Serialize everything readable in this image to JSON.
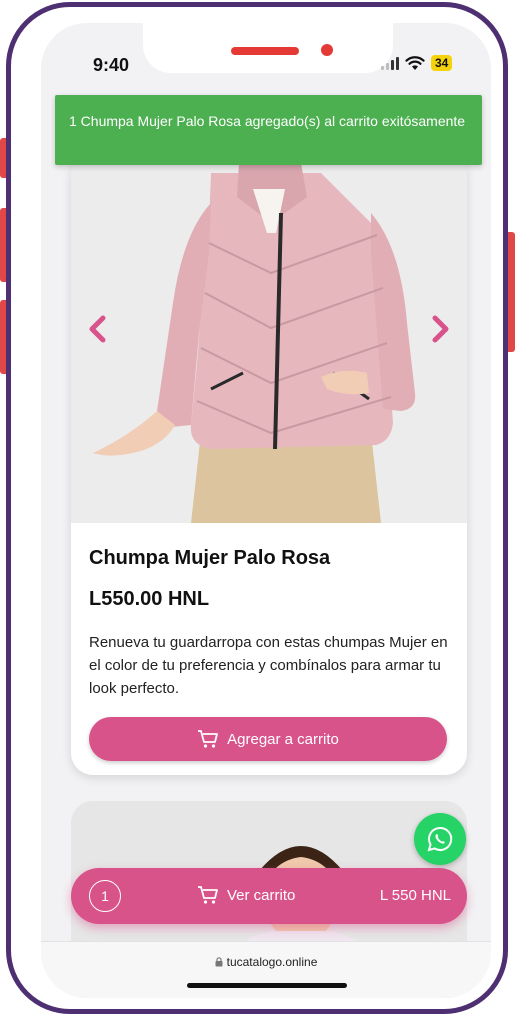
{
  "status_bar": {
    "time": "9:40",
    "battery": "34"
  },
  "toast": {
    "message": "1 Chumpa Mujer Palo Rosa agregado(s) al carrito exitósamente",
    "color": "#4caf50"
  },
  "product": {
    "title": "Chumpa Mujer Palo Rosa",
    "price": "L550.00 HNL",
    "description": "Renueva tu guardarropa con estas chumpas Mujer en el color de tu preferencia y combínalos para armar tu look perfecto.",
    "add_to_cart_label": "Agregar a carrito",
    "prev_icon": "chevron-left-icon",
    "next_icon": "chevron-right-icon"
  },
  "cart_bar": {
    "count": "1",
    "label": "Ver carrito",
    "total": "L 550 HNL"
  },
  "browser": {
    "url": "tucatalogo.online"
  },
  "colors": {
    "accent": "#d9538b",
    "whatsapp": "#25d366",
    "frame": "#4d2f72",
    "success": "#4caf50"
  }
}
